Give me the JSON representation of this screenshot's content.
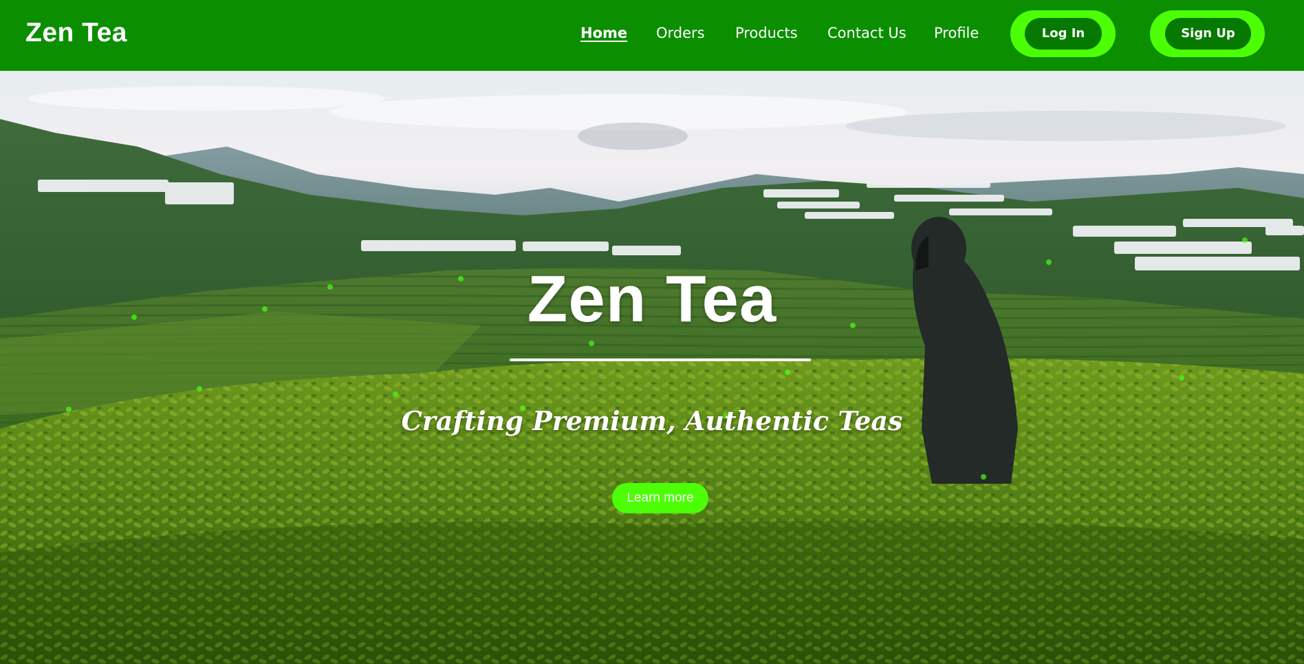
{
  "navbar": {
    "brand": "Zen Tea",
    "links": [
      {
        "label": "Home",
        "active": true
      },
      {
        "label": "Orders",
        "active": false
      },
      {
        "label": "Products",
        "active": false
      },
      {
        "label": "Contact Us",
        "active": false
      },
      {
        "label": "Profile",
        "active": false
      }
    ],
    "login_label": "Log In",
    "signup_label": "Sign Up"
  },
  "hero": {
    "title": "Zen Tea",
    "subtitle": "Crafting Premium, Authentic Teas",
    "cta_label": "Learn more"
  },
  "colors": {
    "nav_background": "#0b8f00",
    "button_outer": "#4cff07",
    "button_inner": "#067a00",
    "cta": "#4cff07",
    "text": "#ffffff"
  }
}
